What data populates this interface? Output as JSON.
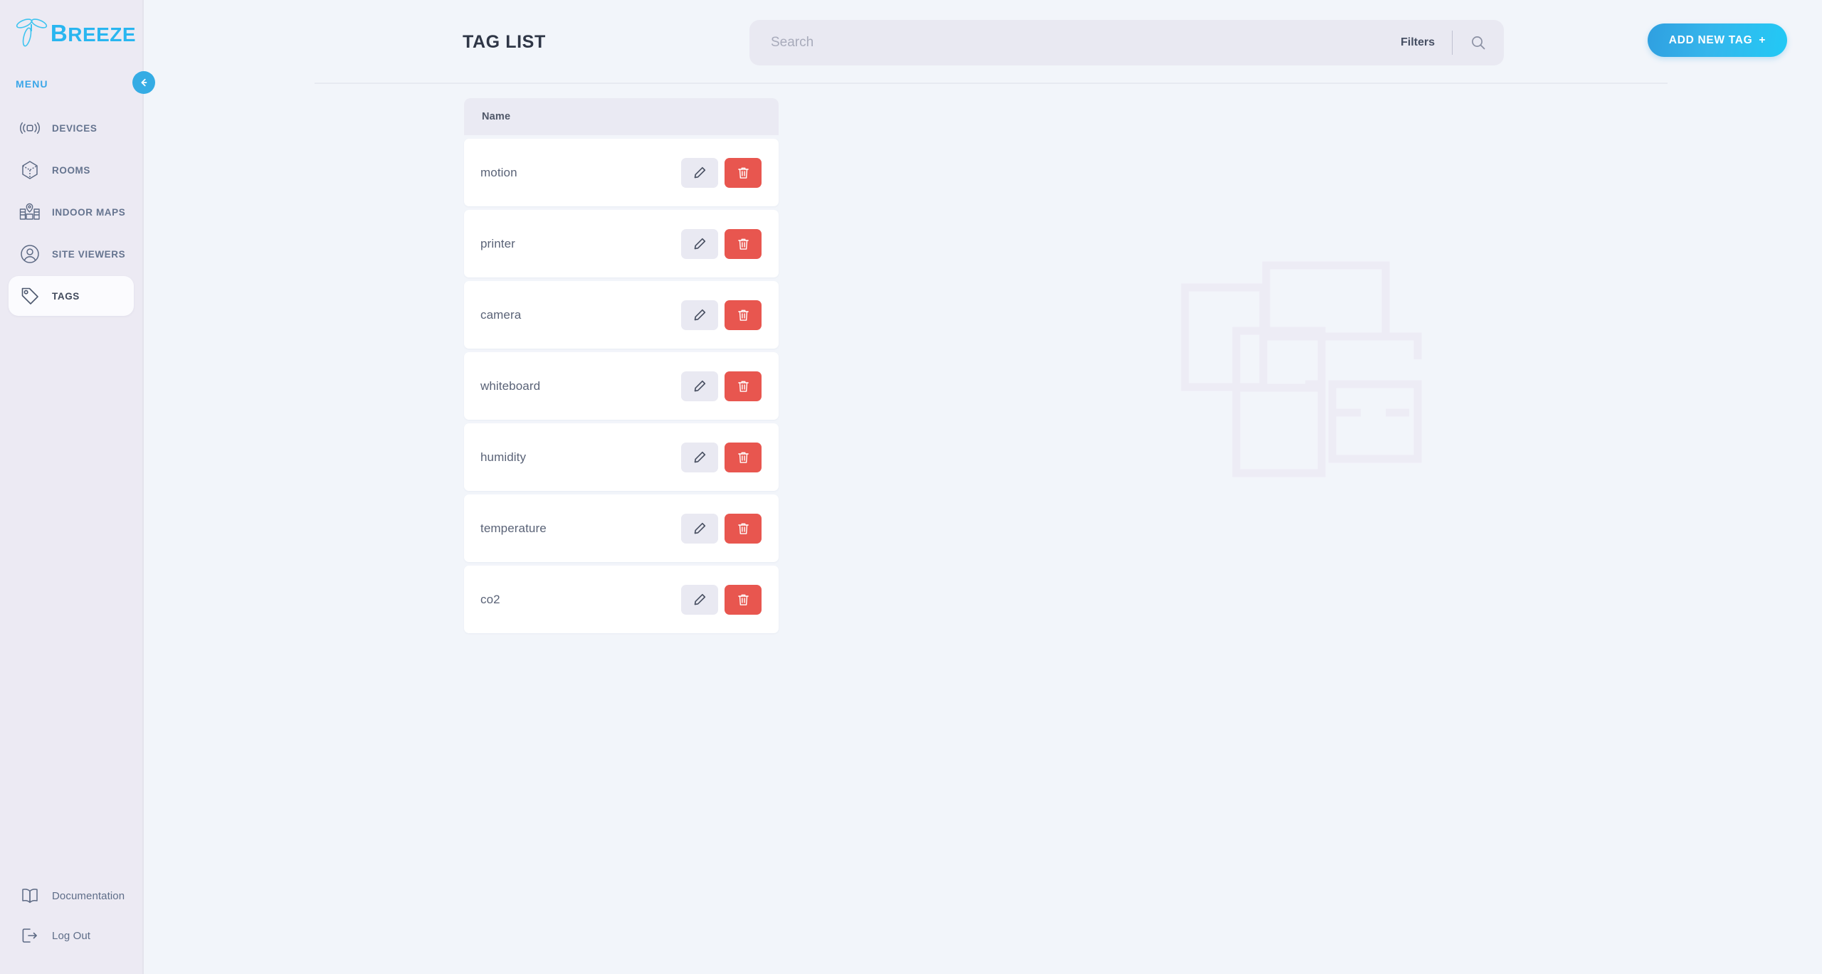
{
  "brand": {
    "name_cap": "B",
    "name_rest": "REEZE",
    "logo_icon": "breeze-propeller-logo"
  },
  "sidebar": {
    "menu_label": "MENU",
    "collapse_icon": "arrow-left-icon",
    "items": [
      {
        "label": "DEVICES",
        "icon": "broadcast-signal-icon",
        "active": false
      },
      {
        "label": "ROOMS",
        "icon": "cube-icon",
        "active": false
      },
      {
        "label": "INDOOR MAPS",
        "icon": "map-building-pin-icon",
        "active": false
      },
      {
        "label": "SITE VIEWERS",
        "icon": "user-circle-icon",
        "active": false
      },
      {
        "label": "TAGS",
        "icon": "tag-icon",
        "active": true
      }
    ],
    "bottom_items": [
      {
        "label": "Documentation",
        "icon": "open-book-icon"
      },
      {
        "label": "Log Out",
        "icon": "logout-arrow-icon"
      }
    ]
  },
  "header": {
    "title": "TAG LIST",
    "search_placeholder": "Search",
    "search_value": "",
    "filters_label": "Filters",
    "search_icon": "magnifier-icon",
    "add_button_label": "ADD NEW TAG",
    "add_button_plus": "+"
  },
  "table": {
    "columns": [
      "Name"
    ],
    "rows": [
      {
        "name": "motion"
      },
      {
        "name": "printer"
      },
      {
        "name": "camera"
      },
      {
        "name": "whiteboard"
      },
      {
        "name": "humidity"
      },
      {
        "name": "temperature"
      },
      {
        "name": "co2"
      }
    ],
    "edit_icon": "pencil-icon",
    "delete_icon": "trash-icon"
  },
  "watermark": {
    "name": "floorplan-watermark"
  },
  "colors": {
    "accent_blue": "#35ace4",
    "accent_cyan": "#22c9f5",
    "danger_red": "#e8564f",
    "sidebar_bg": "#eceaf3",
    "main_bg": "#f2f5fa",
    "watermark": "#eeeef6"
  }
}
